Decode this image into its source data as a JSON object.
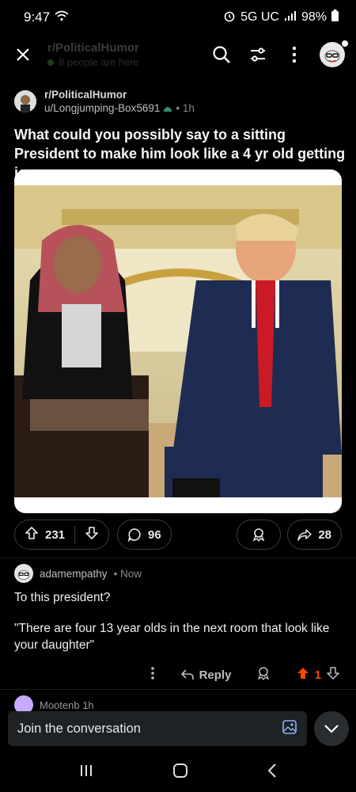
{
  "status_bar": {
    "time": "9:47",
    "network": "5G UC",
    "battery": "98%"
  },
  "top_bar": {
    "subreddit": "r/PoliticalHumor",
    "online": "8 people are here"
  },
  "post": {
    "subreddit": "r/PoliticalHumor",
    "author": "u/Longjumping-Box5691",
    "age": "• 1h",
    "title": "What could you possibly say to a sitting President to make him look like a 4 yr old getting ice cream",
    "upvotes": "231",
    "comments": "96",
    "shares": "28"
  },
  "comment": {
    "user": "adamempathy",
    "time": "• Now",
    "line1": "To this president?",
    "line2": "\"There are four 13 year olds in the next room that look like your daughter\"",
    "reply_label": "Reply",
    "score": "1"
  },
  "next_comment": {
    "preview": "Mootenb 1h"
  },
  "composer": {
    "placeholder": "Join the conversation"
  },
  "colors": {
    "accent_upvote": "#ff4500",
    "background": "#000000"
  }
}
